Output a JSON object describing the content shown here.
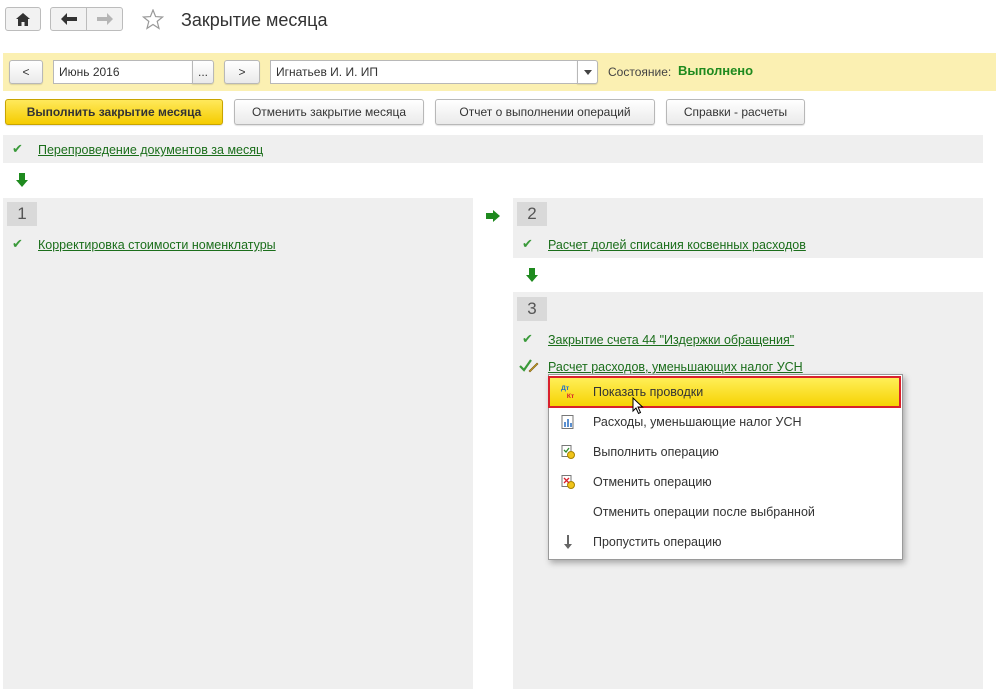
{
  "header": {
    "title": "Закрытие месяца"
  },
  "filters": {
    "period_prev": "<",
    "period_value": "Июнь 2016",
    "period_picker": "...",
    "period_next": ">",
    "organization": "Игнатьев И. И. ИП",
    "state_label": "Состояние:",
    "state_value": "Выполнено"
  },
  "actions": {
    "run": "Выполнить закрытие месяца",
    "cancel": "Отменить закрытие месяца",
    "report": "Отчет о выполнении операций",
    "calc": "Справки - расчеты"
  },
  "steps": {
    "repost": "Перепроведение документов за месяц",
    "block1": {
      "number": "1",
      "items": [
        "Корректировка стоимости номенклатуры"
      ]
    },
    "block2": {
      "number": "2",
      "items": [
        "Расчет долей списания косвенных расходов"
      ]
    },
    "block3": {
      "number": "3",
      "items": [
        "Закрытие счета 44 \"Издержки обращения\"",
        "Расчет расходов, уменьшающих налог УСН"
      ]
    }
  },
  "context_menu": {
    "items": [
      {
        "label": "Показать проводки",
        "icon": "dt-kt-icon"
      },
      {
        "label": "Расходы, уменьшающие налог УСН",
        "icon": "report-icon"
      },
      {
        "label": "Выполнить операцию",
        "icon": "run-operation-icon"
      },
      {
        "label": "Отменить операцию",
        "icon": "cancel-operation-icon"
      },
      {
        "label": "Отменить операции после выбранной",
        "icon": ""
      },
      {
        "label": "Пропустить операцию",
        "icon": "skip-arrow-icon"
      }
    ]
  },
  "colors": {
    "accent_yellow": "#f5cc00",
    "toolbar_band": "#fbf0b2",
    "success_green": "#1b6e1b",
    "highlight_red": "#d9212c"
  }
}
